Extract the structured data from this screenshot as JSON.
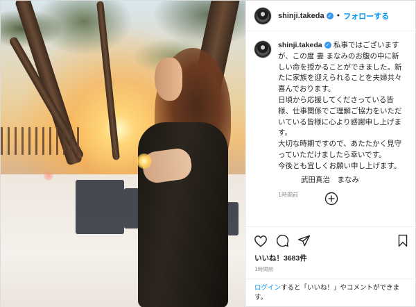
{
  "profile": {
    "username": "shinji.takeda",
    "verified_glyph": "✓",
    "follow_label": "フォローする",
    "separator": "•"
  },
  "caption": {
    "lines": [
      "私事ではございます",
      "が、この度 妻 まなみのお腹の中に新",
      "しい命を授かることができました。新",
      "たに家族を迎えられることを夫婦共々",
      "喜んでおります。",
      "日頃から応援してくださっている皆",
      "様、仕事関係でご理解ご協力をいただ",
      "いている皆様に心より感謝申し上げま",
      "す。",
      "大切な時期ですので、あたたかく見守",
      "っていただけましたら幸いです。",
      "今後とも宜しくお願い申し上げます。"
    ],
    "signature": "武田真治　まなみ",
    "time_ago": "1時間前"
  },
  "actions": {
    "like_icon": "heart-icon",
    "comment_icon": "comment-icon",
    "share_icon": "share-icon",
    "save_icon": "bookmark-icon"
  },
  "likes_text": "いいね！3683件",
  "posted_time": "1時間前",
  "login_prompt": {
    "link": "ログイン",
    "text": "すると「いいね！」やコメントができます。"
  },
  "colors": {
    "accent": "#0095f6",
    "verified": "#3897f0",
    "muted": "#8e8e8e",
    "text": "#262626"
  }
}
